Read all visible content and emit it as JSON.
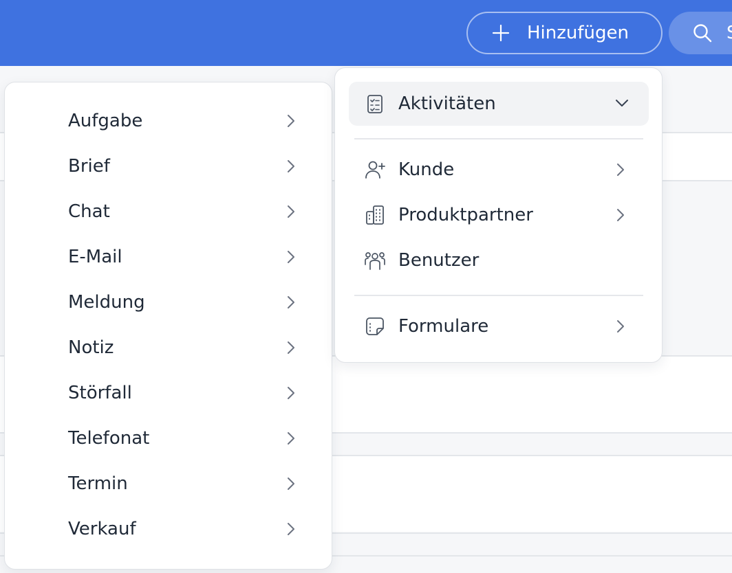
{
  "header": {
    "add_button_label": "Hinzufügen",
    "search_label": "Suchen",
    "background_color": "#3f72e0"
  },
  "dropdown": {
    "items": [
      {
        "label": "Aktivitäten",
        "icon": "clipboard-list-icon",
        "expanded": true
      },
      {
        "label": "Kunde",
        "icon": "user-plus-icon"
      },
      {
        "label": "Produktpartner",
        "icon": "building-icon"
      },
      {
        "label": "Benutzer",
        "icon": "users-group-icon"
      },
      {
        "label": "Formulare",
        "icon": "form-note-icon"
      }
    ]
  },
  "submenu": {
    "items": [
      {
        "label": "Aufgabe"
      },
      {
        "label": "Brief"
      },
      {
        "label": "Chat"
      },
      {
        "label": "E-Mail"
      },
      {
        "label": "Meldung"
      },
      {
        "label": "Notiz"
      },
      {
        "label": "Störfall"
      },
      {
        "label": "Telefonat"
      },
      {
        "label": "Termin"
      },
      {
        "label": "Verkauf"
      }
    ]
  }
}
